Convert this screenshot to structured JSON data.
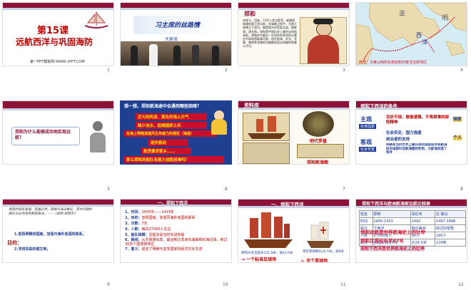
{
  "slides": [
    {
      "num": "1",
      "title_line1": "第15课",
      "title_line2": "远航西洋与巩固海防",
      "footer": "第一PPT模板网-WWW.1PPT.COM"
    },
    {
      "num": "2",
      "caption": "大家谈",
      "banner": "习主席的丝路情"
    },
    {
      "num": "3",
      "heading": "郑和",
      "body": "本姓马，回族，12岁入宫当宦官，被赐则朱棣的燕王府当差，在靖难之役中，为燕王朱棣立下战功，被提拔为内官监太监，赐姓郑，改名和。郑和是中国历史上最杰出的航海家。郑和的才能在一生研究的多项伟大事业中体现得淋漓尽致，他在航海、外交、军事、建筑等领域的贡献都体现出卓越的智慧与才识。"
    },
    {
      "num": "4",
      "caption": "西洋：文莱以西的东南亚和印度洋沿岸地区",
      "map_labels": [
        "亚",
        "西",
        "洋",
        "明"
      ]
    },
    {
      "num": "5",
      "question": "郑和为什么能够成功地实现远航？"
    },
    {
      "num": "6",
      "title": "想一想，郑和航海途中会遇到哪些困难？",
      "items": [
        "巨大的风浪、莫名的海上天气",
        "缺少淡水、疫病困扰士兵",
        "在海上明暗流强风生存威力的侵犯（海盗）",
        "迷失航向",
        "航员要求家乡……",
        "那么郑和的船队有能力战胜困难吗？"
      ]
    },
    {
      "num": "7",
      "heading": "资料库",
      "labels": [
        "明代罗盘",
        "郑和航海图"
      ]
    },
    {
      "num": "8",
      "heading": "郑和下西洋的条件",
      "subj": "主观",
      "subj_tag": "自身因素",
      "obj": "客观",
      "obj_tag": "社会背景",
      "subj_text": "百折不挠、敢敢谨慎、不畏艰难的探险精神",
      "obj_text1": "社会安定，国力强盛",
      "obj_text2": "统治者的支持",
      "obj_text3": "明朝有当时世界上最先进的造船技术和航海技术指南针及航海图的利用，为航海创造了条件",
      "side": [
        "国家",
        "个人"
      ]
    },
    {
      "num": "9",
      "quote": "我国的国家富强，国强必然，若振兴海洋事业，西方列强的舰队也必然来到我国海洋。——《郑和·郑和传》",
      "purpose_label": "目的：",
      "purpose1": "1.宣扬明朝的国威，加强与海外各国的联系。",
      "purpose2": "2.寻找失踪的建文帝。"
    },
    {
      "num": "10",
      "heading": "一、郑和下西洋",
      "rows": [
        {
          "k": "1、时间：",
          "v": "1405年——1433年"
        },
        {
          "k": "2、目的：",
          "v": "宣扬国威，加强同海外各国的联系"
        },
        {
          "k": "3、次数：",
          "v": "7次"
        },
        {
          "k": "4、人数：",
          "v": "每次27000人左右"
        },
        {
          "k": "5、船队规模：",
          "v": "宝船多是当时先进的船"
        },
        {
          "k": "6、路线：",
          "v": "从刘家港出发，最远到达非洲东海岸和红海沿岸，到过30多个国家和地区"
        },
        {
          "k": "7、",
          "v": ""
        },
        {
          "k": "意义：",
          "v": "促进了明朝与亚非国家的经济文化交流"
        }
      ]
    },
    {
      "num": "11",
      "heading": "一、郑和下西洋",
      "cap1": "郑和大号宝船长151.8米，宽61.6米",
      "cap2": "→ 一个标准足球场",
      "cap3": "哥伦布旗舰长24.5米，宽8米",
      "cap4": "← 半个篮球场"
    },
    {
      "num": "12",
      "heading": "郑和下西洋与欧洲航海家远航比较表",
      "headers": [
        "姓名",
        "郑和",
        "哥伦布",
        "达·伽马"
      ],
      "rows": [
        [
          "时间",
          "1405-1433",
          "1492",
          "1497-1498"
        ],
        [
          "船只",
          "下西洋",
          "到达美洲",
          "绕过好望角"
        ],
        [
          "人数",
          "27000余人",
          "90人",
          "160人"
        ],
        [
          "船长",
          "宝船长151.8米",
          "长24.5米",
          "120吨"
        ]
      ],
      "overlay1": "郑和远航是世界航海史上的壮举",
      "overlay2": "郑和比哥伦布早87年",
      "overlay3": "郑和下西洋是世界航海史上的壮举"
    }
  ]
}
